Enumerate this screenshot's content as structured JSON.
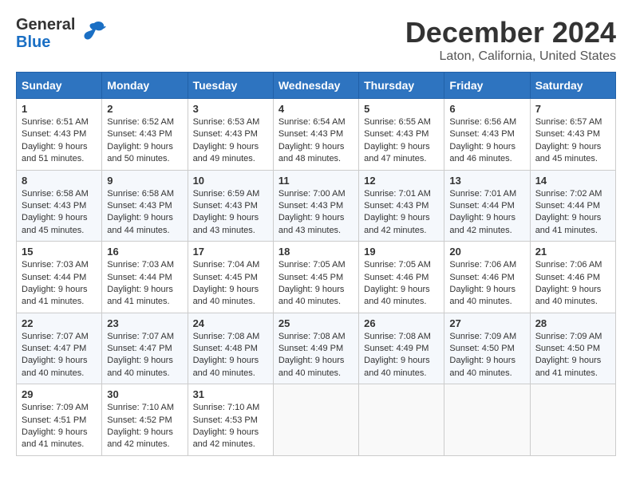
{
  "logo": {
    "line1": "General",
    "line2": "Blue"
  },
  "title": "December 2024",
  "subtitle": "Laton, California, United States",
  "days_of_week": [
    "Sunday",
    "Monday",
    "Tuesday",
    "Wednesday",
    "Thursday",
    "Friday",
    "Saturday"
  ],
  "weeks": [
    [
      {
        "day": "1",
        "info": "Sunrise: 6:51 AM\nSunset: 4:43 PM\nDaylight: 9 hours\nand 51 minutes."
      },
      {
        "day": "2",
        "info": "Sunrise: 6:52 AM\nSunset: 4:43 PM\nDaylight: 9 hours\nand 50 minutes."
      },
      {
        "day": "3",
        "info": "Sunrise: 6:53 AM\nSunset: 4:43 PM\nDaylight: 9 hours\nand 49 minutes."
      },
      {
        "day": "4",
        "info": "Sunrise: 6:54 AM\nSunset: 4:43 PM\nDaylight: 9 hours\nand 48 minutes."
      },
      {
        "day": "5",
        "info": "Sunrise: 6:55 AM\nSunset: 4:43 PM\nDaylight: 9 hours\nand 47 minutes."
      },
      {
        "day": "6",
        "info": "Sunrise: 6:56 AM\nSunset: 4:43 PM\nDaylight: 9 hours\nand 46 minutes."
      },
      {
        "day": "7",
        "info": "Sunrise: 6:57 AM\nSunset: 4:43 PM\nDaylight: 9 hours\nand 45 minutes."
      }
    ],
    [
      {
        "day": "8",
        "info": "Sunrise: 6:58 AM\nSunset: 4:43 PM\nDaylight: 9 hours\nand 45 minutes."
      },
      {
        "day": "9",
        "info": "Sunrise: 6:58 AM\nSunset: 4:43 PM\nDaylight: 9 hours\nand 44 minutes."
      },
      {
        "day": "10",
        "info": "Sunrise: 6:59 AM\nSunset: 4:43 PM\nDaylight: 9 hours\nand 43 minutes."
      },
      {
        "day": "11",
        "info": "Sunrise: 7:00 AM\nSunset: 4:43 PM\nDaylight: 9 hours\nand 43 minutes."
      },
      {
        "day": "12",
        "info": "Sunrise: 7:01 AM\nSunset: 4:43 PM\nDaylight: 9 hours\nand 42 minutes."
      },
      {
        "day": "13",
        "info": "Sunrise: 7:01 AM\nSunset: 4:44 PM\nDaylight: 9 hours\nand 42 minutes."
      },
      {
        "day": "14",
        "info": "Sunrise: 7:02 AM\nSunset: 4:44 PM\nDaylight: 9 hours\nand 41 minutes."
      }
    ],
    [
      {
        "day": "15",
        "info": "Sunrise: 7:03 AM\nSunset: 4:44 PM\nDaylight: 9 hours\nand 41 minutes."
      },
      {
        "day": "16",
        "info": "Sunrise: 7:03 AM\nSunset: 4:44 PM\nDaylight: 9 hours\nand 41 minutes."
      },
      {
        "day": "17",
        "info": "Sunrise: 7:04 AM\nSunset: 4:45 PM\nDaylight: 9 hours\nand 40 minutes."
      },
      {
        "day": "18",
        "info": "Sunrise: 7:05 AM\nSunset: 4:45 PM\nDaylight: 9 hours\nand 40 minutes."
      },
      {
        "day": "19",
        "info": "Sunrise: 7:05 AM\nSunset: 4:46 PM\nDaylight: 9 hours\nand 40 minutes."
      },
      {
        "day": "20",
        "info": "Sunrise: 7:06 AM\nSunset: 4:46 PM\nDaylight: 9 hours\nand 40 minutes."
      },
      {
        "day": "21",
        "info": "Sunrise: 7:06 AM\nSunset: 4:46 PM\nDaylight: 9 hours\nand 40 minutes."
      }
    ],
    [
      {
        "day": "22",
        "info": "Sunrise: 7:07 AM\nSunset: 4:47 PM\nDaylight: 9 hours\nand 40 minutes."
      },
      {
        "day": "23",
        "info": "Sunrise: 7:07 AM\nSunset: 4:47 PM\nDaylight: 9 hours\nand 40 minutes."
      },
      {
        "day": "24",
        "info": "Sunrise: 7:08 AM\nSunset: 4:48 PM\nDaylight: 9 hours\nand 40 minutes."
      },
      {
        "day": "25",
        "info": "Sunrise: 7:08 AM\nSunset: 4:49 PM\nDaylight: 9 hours\nand 40 minutes."
      },
      {
        "day": "26",
        "info": "Sunrise: 7:08 AM\nSunset: 4:49 PM\nDaylight: 9 hours\nand 40 minutes."
      },
      {
        "day": "27",
        "info": "Sunrise: 7:09 AM\nSunset: 4:50 PM\nDaylight: 9 hours\nand 40 minutes."
      },
      {
        "day": "28",
        "info": "Sunrise: 7:09 AM\nSunset: 4:50 PM\nDaylight: 9 hours\nand 41 minutes."
      }
    ],
    [
      {
        "day": "29",
        "info": "Sunrise: 7:09 AM\nSunset: 4:51 PM\nDaylight: 9 hours\nand 41 minutes."
      },
      {
        "day": "30",
        "info": "Sunrise: 7:10 AM\nSunset: 4:52 PM\nDaylight: 9 hours\nand 42 minutes."
      },
      {
        "day": "31",
        "info": "Sunrise: 7:10 AM\nSunset: 4:53 PM\nDaylight: 9 hours\nand 42 minutes."
      },
      {
        "day": "",
        "info": ""
      },
      {
        "day": "",
        "info": ""
      },
      {
        "day": "",
        "info": ""
      },
      {
        "day": "",
        "info": ""
      }
    ]
  ]
}
